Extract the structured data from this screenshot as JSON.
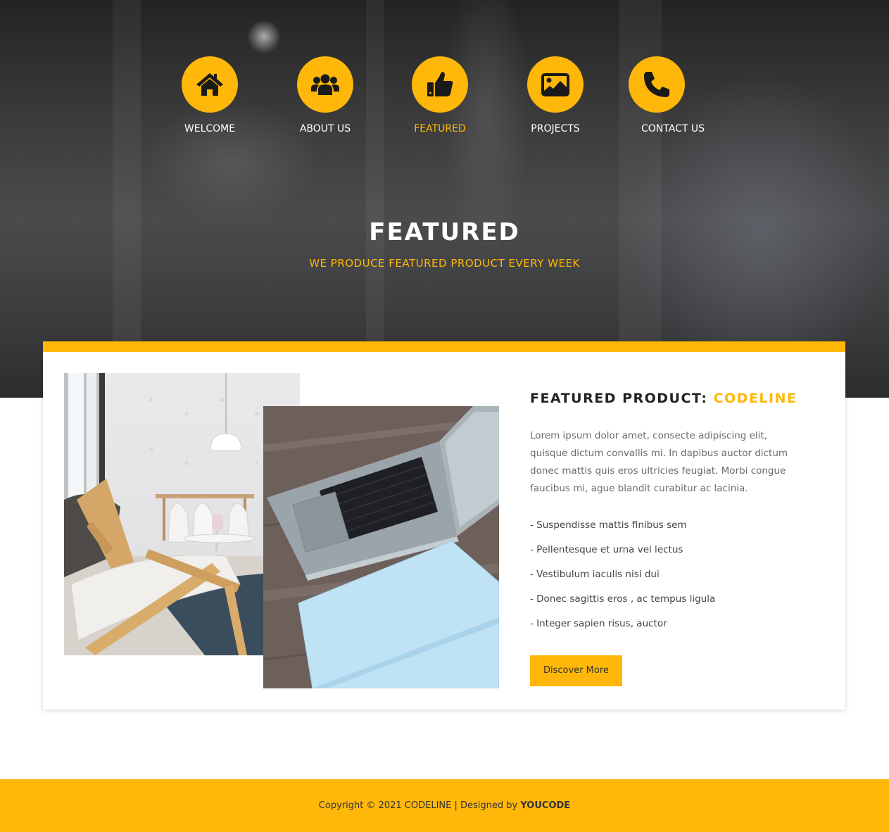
{
  "colors": {
    "accent": "#ffb70a",
    "hero_text": "#ffffff",
    "body_text": "#6b6b6b",
    "dark_text": "#222222"
  },
  "nav": {
    "items": [
      {
        "label": "WELCOME",
        "icon": "home-icon",
        "active": false
      },
      {
        "label": "ABOUT US",
        "icon": "users-icon",
        "active": false
      },
      {
        "label": "FEATURED",
        "icon": "thumbs-up-icon",
        "active": true
      },
      {
        "label": "PROJECTS",
        "icon": "image-icon",
        "active": false
      },
      {
        "label": "CONTACT US",
        "icon": "phone-icon",
        "active": false
      }
    ]
  },
  "hero": {
    "title": "FEATURED",
    "subtitle": "WE PRODUCE FEATURED PRODUCT EVERY WEEK"
  },
  "product": {
    "title_prefix": "FEATURED PRODUCT:",
    "title_brand": "CODELINE",
    "description": "Lorem ipsum dolor amet, consecte adipiscing elit, quisque dictum convallis mi. In dapibus auctor dictum donec mattis quis eros ultricies feugiat. Morbi congue faucibus mi, ague blandit curabitur ac lacinia.",
    "features": [
      "- Suspendisse mattis finibus sem",
      "- Pellentesque et urna vel lectus",
      "- Vestibulum iaculis nisi dui",
      "- Donec sagittis eros , ac tempus ligula",
      "- Integer sapien risus, auctor"
    ],
    "button_label": "Discover More"
  },
  "footer": {
    "copyright": "Copyright © 2021 CODELINE | Designed by",
    "designer": "YOUCODE"
  }
}
